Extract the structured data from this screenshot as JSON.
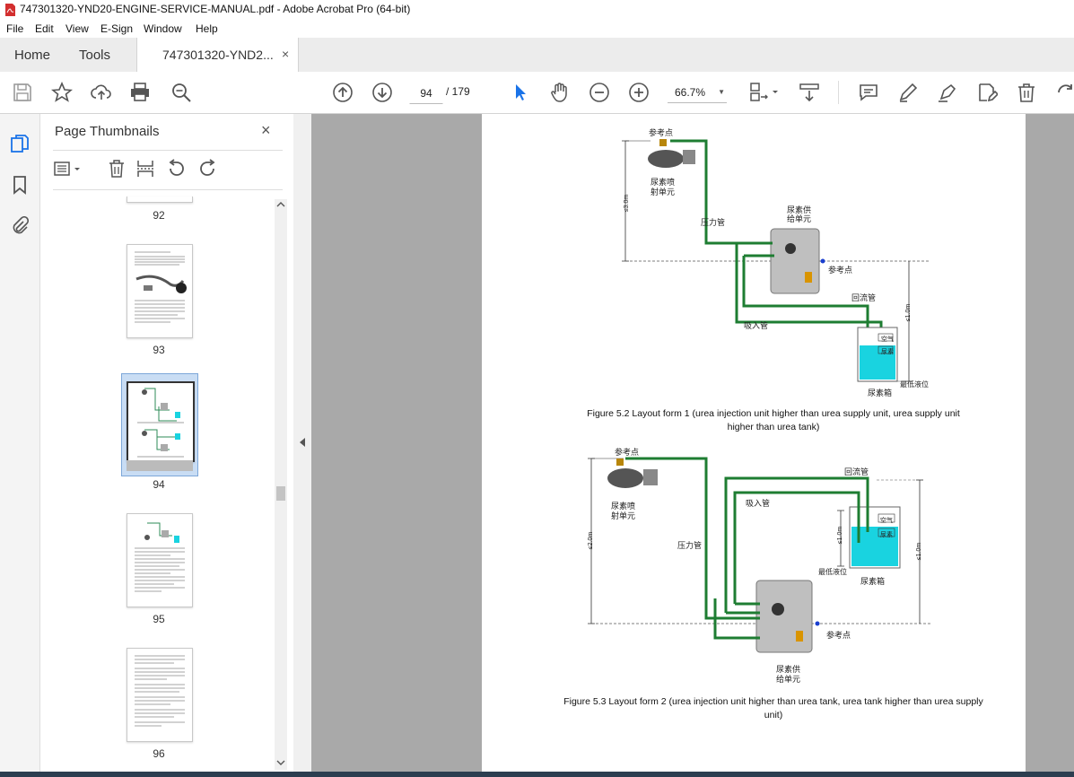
{
  "window": {
    "title": "747301320-YND20-ENGINE-SERVICE-MANUAL.pdf - Adobe Acrobat Pro (64-bit)"
  },
  "menu": [
    "File",
    "Edit",
    "View",
    "E-Sign",
    "Window",
    "Help"
  ],
  "tabs": {
    "home": "Home",
    "tools": "Tools",
    "document": "747301320-YND2...",
    "close": "×"
  },
  "toolbar": {
    "page_current": "94",
    "page_total": "/ 179",
    "zoom": "66.7%"
  },
  "thumbnails_panel": {
    "title": "Page Thumbnails",
    "close": "×",
    "pages": [
      {
        "number": "92"
      },
      {
        "number": "93"
      },
      {
        "number": "94",
        "selected": true
      },
      {
        "number": "95"
      },
      {
        "number": "96"
      }
    ]
  },
  "document": {
    "figure1": {
      "caption_line1": "Figure 5.2 Layout form 1 (urea injection unit higher than urea supply unit, urea supply unit",
      "caption_line2": "higher than urea tank)",
      "labels": {
        "ref_top": "参考点",
        "inj_unit_1": "尿素喷",
        "inj_unit_2": "射单元",
        "pressure_pipe": "压力管",
        "supply_1": "尿素供",
        "supply_2": "给单元",
        "ref_mid": "参考点",
        "return_pipe": "回流管",
        "suction_pipe": "吸入管",
        "air": "空气",
        "urea": "尿素",
        "min_level": "最低液位",
        "tank": "尿素箱",
        "dim_left": "≤3.0m",
        "dim_right": "≤1.0m"
      }
    },
    "figure2": {
      "caption_line1": "Figure 5.3 Layout form 2 (urea injection unit higher than urea tank, urea tank higher than urea supply",
      "caption_line2": "unit)",
      "labels": {
        "ref_top": "参考点",
        "inj_unit_1": "尿素喷",
        "inj_unit_2": "射单元",
        "return_pipe": "回流管",
        "suction_pipe": "吸入管",
        "pressure_pipe": "压力管",
        "air": "空气",
        "urea": "尿素",
        "min_level": "最低液位",
        "tank": "尿素箱",
        "ref_bottom": "参考点",
        "supply_1": "尿素供",
        "supply_2": "给单元",
        "dim_left": "≤2.0m",
        "dim_mid": "≤1.0m",
        "dim_right": "≤1.0m"
      }
    }
  },
  "colors": {
    "pipe": "#1e7d32",
    "urea_fluid": "#19d3e0",
    "page_bg": "#a9a9a9",
    "accent_blue": "#1a73e8"
  }
}
